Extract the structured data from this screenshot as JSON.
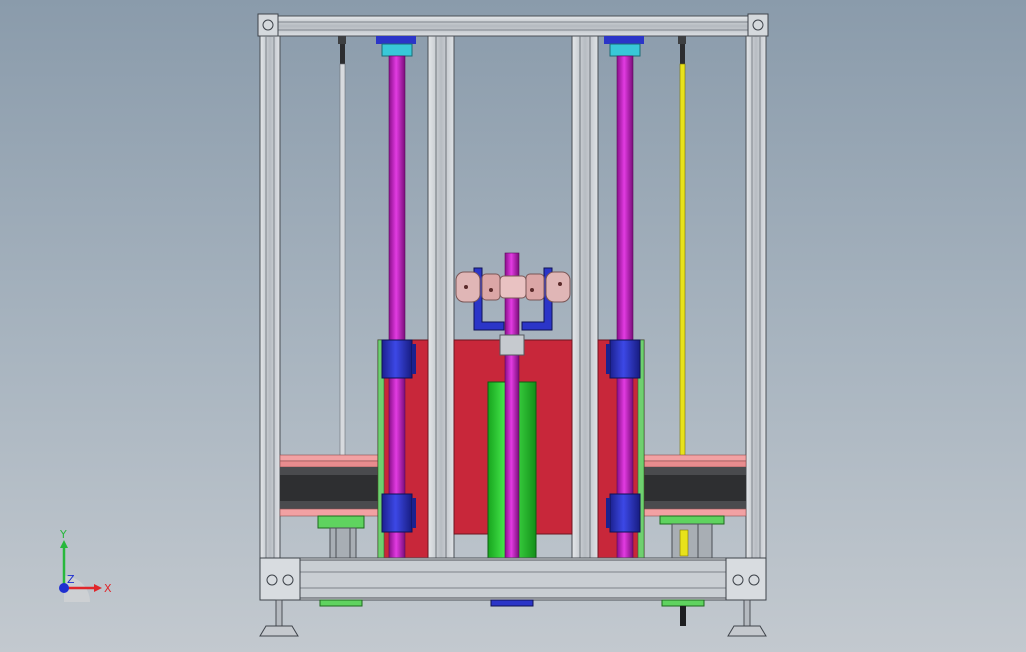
{
  "triad": {
    "x_label": "X",
    "y_label": "Y",
    "z_label": "Z",
    "x_color": "#e0262b",
    "y_color": "#28b83c",
    "z_color": "#1f2fd0"
  },
  "colors": {
    "background_top": "#8a9bab",
    "background_bottom": "#c3c9cf",
    "frame_aluminum": "#c8ccd1",
    "column_magenta": "#c418c4",
    "rod_yellow": "#e8e21a",
    "plate_red": "#c8273a",
    "block_blue": "#2b35c8",
    "cylinder_green": "#27d62f",
    "bearing_cyan": "#38c8d8",
    "belt_dark": "#2e2f31",
    "belt_pink": "#f2a1a3"
  }
}
